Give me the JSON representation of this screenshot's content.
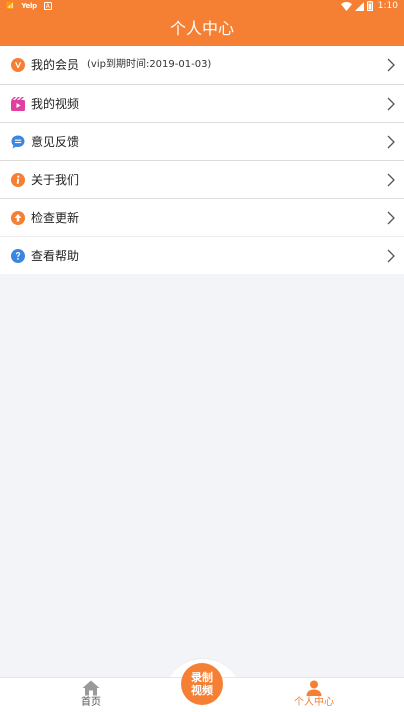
{
  "status_bar": {
    "left_items": [
      "📶",
      "Yelp",
      "A"
    ],
    "time": "1:10"
  },
  "header": {
    "title": "个人中心",
    "color": "#f57f33"
  },
  "menu": {
    "items": [
      {
        "icon": "vip-icon",
        "label": "我的会员",
        "sub": "(vip到期时间:2019-01-03)",
        "icon_color": "#f57f33"
      },
      {
        "icon": "video-icon",
        "label": "我的视频",
        "icon_color": "#e040a0"
      },
      {
        "icon": "feedback-icon",
        "label": "意见反馈",
        "icon_color": "#3a86e0"
      },
      {
        "icon": "info-icon",
        "label": "关于我们",
        "icon_color": "#f57f33"
      },
      {
        "icon": "update-icon",
        "label": "检查更新",
        "icon_color": "#f57f33"
      },
      {
        "icon": "help-icon",
        "label": "查看帮助",
        "icon_color": "#3a86e0"
      }
    ]
  },
  "bottom_nav": {
    "home_label": "首页",
    "record_line1": "录制",
    "record_line2": "视频",
    "me_label": "个人中心",
    "active_color": "#f57f33"
  }
}
